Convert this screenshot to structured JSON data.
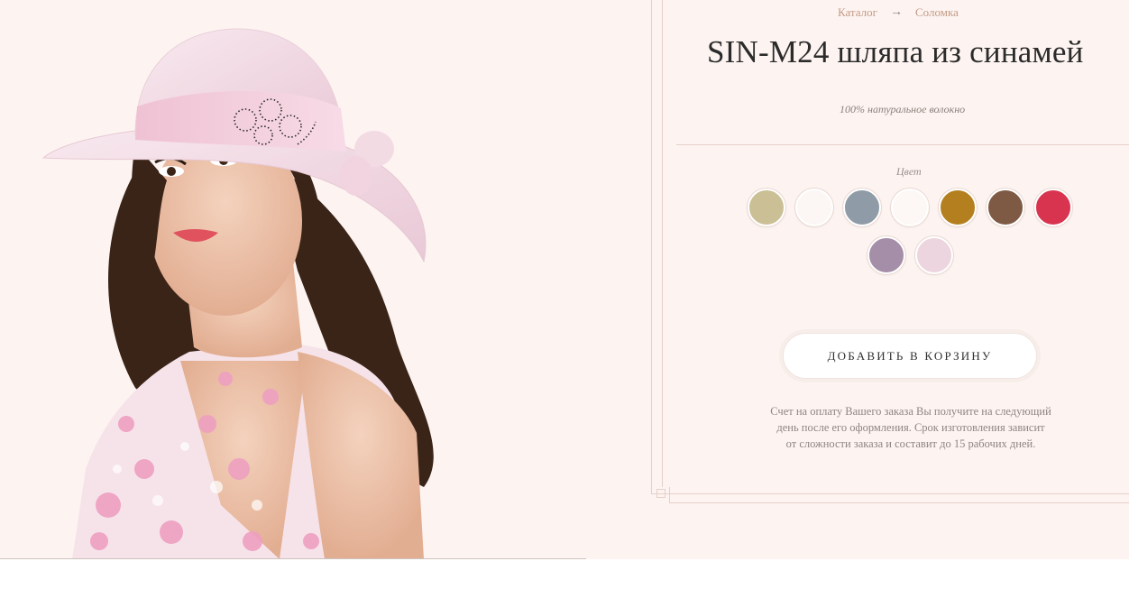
{
  "breadcrumb": {
    "catalog": "Каталог",
    "arrow": "→",
    "category": "Соломка"
  },
  "product": {
    "title": "SIN-M24 шляпа из синамей",
    "subtitle": "100% натуральное волокно",
    "color_label": "Цвет"
  },
  "swatches": [
    {
      "color": "#cbbf96",
      "name": "beige"
    },
    {
      "color": "#fcf7f5",
      "name": "white"
    },
    {
      "color": "#8f9ba6",
      "name": "grey-blue"
    },
    {
      "color": "#fdf8f6",
      "name": "ivory"
    },
    {
      "color": "#b4801f",
      "name": "mustard"
    },
    {
      "color": "#7e5a44",
      "name": "brown"
    },
    {
      "color": "#d8344f",
      "name": "raspberry"
    },
    {
      "color": "#a58ea8",
      "name": "lilac"
    },
    {
      "color": "#ecd5de",
      "name": "light-pink"
    }
  ],
  "cart": {
    "label": "ДОБАВИТЬ В КОРЗИНУ"
  },
  "note": {
    "line1": "Счет на оплату Вашего заказа Вы получите на следующий",
    "line2": "день после его оформления. Срок изготовления зависит",
    "line3": "от сложности заказа и составит до 15 рабочих дней."
  },
  "colors": {
    "background": "#fdf4f1",
    "accent": "#c49a86",
    "frame": "#e6cfc8"
  }
}
